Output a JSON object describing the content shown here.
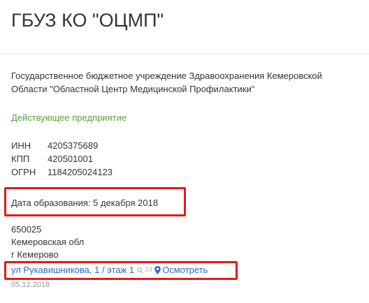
{
  "header": {
    "title": "ГБУЗ КО \"ОЦМП\""
  },
  "org": {
    "full_name": "Государственное бюджетное учреждение Здравоохранения Кемеровской Области \"Областной Центр Медицинской Профилактики\"",
    "status": "Действующее предприятие",
    "requisites": [
      {
        "label": "ИНН",
        "value": "4205375689"
      },
      {
        "label": "КПП",
        "value": "420501001"
      },
      {
        "label": "ОГРН",
        "value": "1184205024123"
      }
    ],
    "founded": "Дата образования: 5 декабря 2018"
  },
  "address": {
    "zip": "650025",
    "region": "Кемеровская обл",
    "city": "г Кемерово",
    "street_link": "ул Рукавишникова, 1 / этаж 1",
    "views": "24",
    "view_link": "Осмотреть",
    "date": "05.12.2018"
  },
  "colors": {
    "status_green": "#5aa13b",
    "link_blue": "#2a6bbf",
    "highlight_red": "#e21b1b"
  },
  "icons": [
    "magnifier-icon",
    "map-pin-icon"
  ]
}
